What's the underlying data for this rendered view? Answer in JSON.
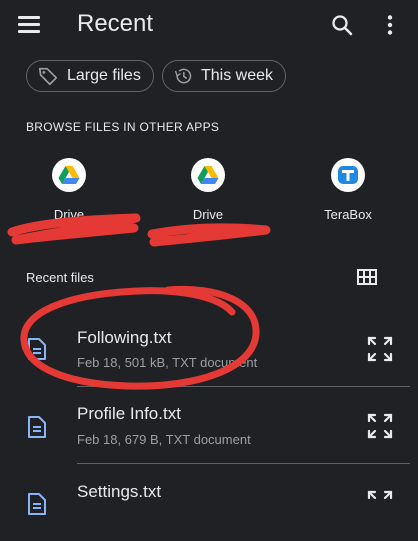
{
  "header": {
    "title": "Recent"
  },
  "chips": [
    {
      "label": "Large files",
      "icon": "tag-icon"
    },
    {
      "label": "This week",
      "icon": "history-icon"
    }
  ],
  "browse": {
    "heading": "BROWSE FILES IN OTHER APPS",
    "apps": [
      {
        "label": "Drive",
        "icon": "google-drive-icon"
      },
      {
        "label": "Drive",
        "icon": "google-drive-icon"
      },
      {
        "label": "TeraBox",
        "icon": "terabox-icon"
      }
    ]
  },
  "recent": {
    "label": "Recent files",
    "files": [
      {
        "name": "Following.txt",
        "meta": "Feb 18, 501 kB, TXT document"
      },
      {
        "name": "Profile Info.txt",
        "meta": "Feb 18, 679 B, TXT document"
      },
      {
        "name": "Settings.txt",
        "meta": ""
      }
    ]
  },
  "colors": {
    "background": "#202124",
    "text": "#e8eaed",
    "secondary_text": "#9aa0a6",
    "file_icon": "#8ab4f8",
    "annotation_red": "#e53935"
  }
}
